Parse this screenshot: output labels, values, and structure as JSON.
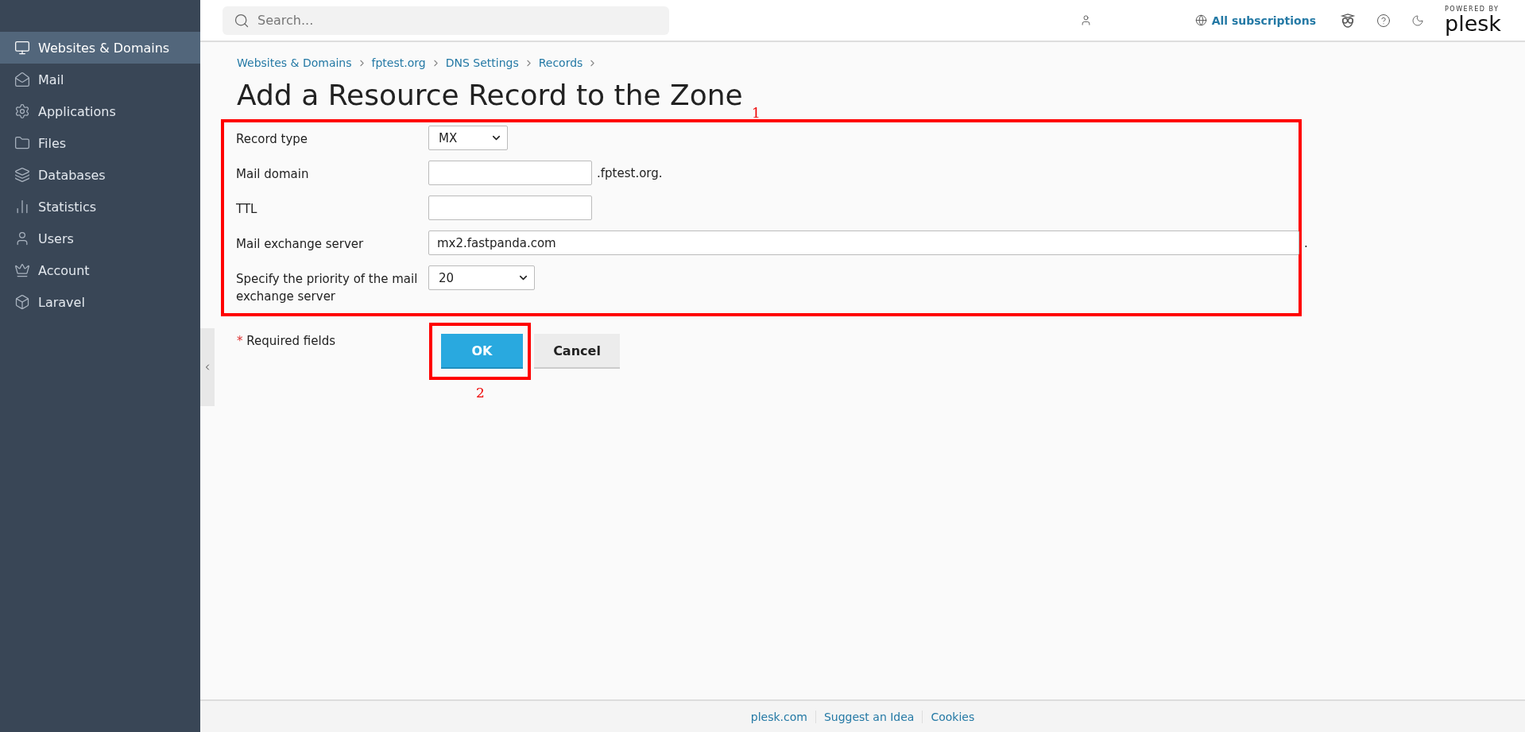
{
  "sidebar": {
    "items": [
      {
        "label": "Websites & Domains",
        "selected": true
      },
      {
        "label": "Mail",
        "selected": false
      },
      {
        "label": "Applications",
        "selected": false
      },
      {
        "label": "Files",
        "selected": false
      },
      {
        "label": "Databases",
        "selected": false
      },
      {
        "label": "Statistics",
        "selected": false
      },
      {
        "label": "Users",
        "selected": false
      },
      {
        "label": "Account",
        "selected": false
      },
      {
        "label": "Laravel",
        "selected": false
      }
    ]
  },
  "topbar": {
    "search": {
      "placeholder": "Search..."
    },
    "subscriptions": "All subscriptions",
    "brand": {
      "tagline": "POWERED BY",
      "name": "plesk"
    }
  },
  "breadcrumbs": [
    "Websites & Domains",
    "fptest.org",
    "DNS Settings",
    "Records"
  ],
  "title": "Add a Resource Record to the Zone",
  "form": {
    "annotation": "1",
    "rows": [
      {
        "kind": "select",
        "label": "Record type",
        "value": "MX"
      },
      {
        "kind": "input",
        "label": "Mail domain",
        "value": "",
        "suffix": ".fptest.org."
      },
      {
        "kind": "input",
        "label": "TTL",
        "value": ""
      },
      {
        "kind": "input",
        "label": "Mail exchange server",
        "value": "mx2.fastpanda.com",
        "suffix": "."
      },
      {
        "kind": "select",
        "label": "Specify the priority of the mail exchange server",
        "value": "20"
      }
    ]
  },
  "required": {
    "mark": "*",
    "text": "Required fields"
  },
  "buttons": [
    {
      "label": "OK",
      "kind": "primary",
      "annotation": "2"
    },
    {
      "label": "Cancel",
      "kind": "secondary"
    }
  ],
  "footer": [
    "plesk.com",
    "Suggest an Idea",
    "Cookies"
  ]
}
